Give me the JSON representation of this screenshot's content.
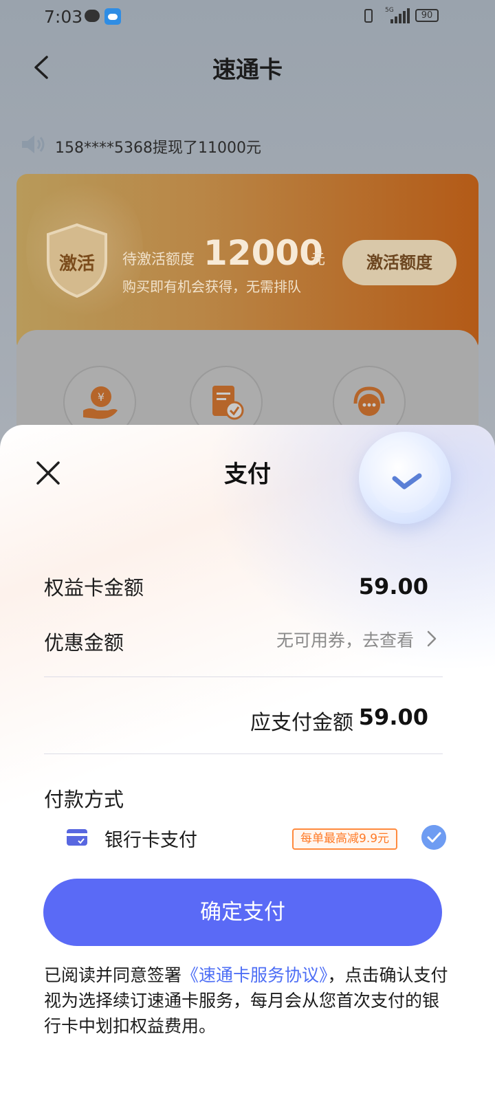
{
  "status_bar": {
    "time": "7:03",
    "network": "5G",
    "battery": "90"
  },
  "header": {
    "title": "速通卡"
  },
  "notice": {
    "text": "158****5368提现了11000元"
  },
  "promo": {
    "shield_text": "激活",
    "quota_label": "待激活额度",
    "quota_amount": "12000",
    "quota_unit": "元",
    "subtitle": "购买即有机会获得，无需排队",
    "activate_button": "激活额度"
  },
  "services": {
    "icons": [
      "yuan-hand-icon",
      "document-check-icon",
      "customer-service-icon"
    ]
  },
  "payment_sheet": {
    "title": "支付",
    "card_amount_label": "权益卡金额",
    "card_amount_value": "59.00",
    "discount_label": "优惠金额",
    "discount_value": "无可用券，去查看",
    "total_label": "应支付金额",
    "total_value": "59.00",
    "method_title": "付款方式",
    "bank_card_label": "银行卡支付",
    "bank_card_badge": "每单最高减9.9元",
    "confirm_button": "确定支付",
    "agreement_prefix": "已阅读并同意签署",
    "agreement_link": "《速通卡服务协议》",
    "agreement_suffix": "，点击确认支付视为选择续订速通卡服务，每月会从您首次支付的银行卡中划扣权益费用。"
  },
  "colors": {
    "primary_button": "#5a6af6",
    "link": "#4d6ef5",
    "badge_orange": "#ff7a26",
    "radio_checked": "#6e9cf2"
  }
}
